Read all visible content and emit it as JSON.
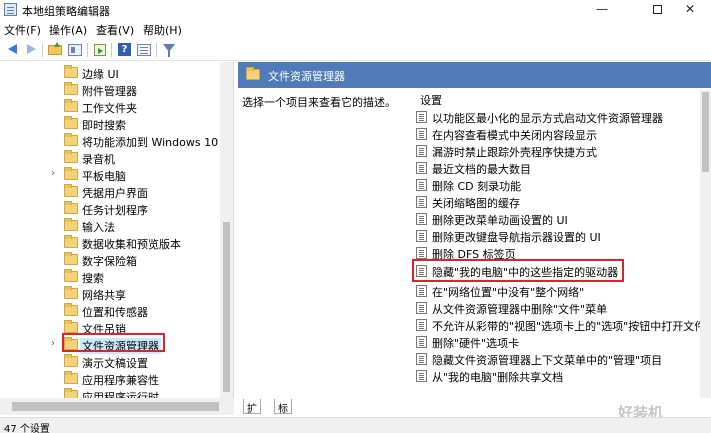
{
  "window": {
    "title": "本地组策略编辑器",
    "controls": {
      "minimize": "—",
      "close": "✕"
    }
  },
  "menu": [
    "文件(F)",
    "操作(A)",
    "查看(V)",
    "帮助(H)"
  ],
  "toolbar_icons": [
    "back-icon",
    "forward-icon",
    "folder-up-icon",
    "show-hide-tree-icon",
    "export-icon",
    "help-icon",
    "properties-icon",
    "filter-icon"
  ],
  "tree": {
    "items": [
      {
        "label": "边缘 UI",
        "expandable": false
      },
      {
        "label": "附件管理器",
        "expandable": false
      },
      {
        "label": "工作文件夹",
        "expandable": false
      },
      {
        "label": "即时搜索",
        "expandable": false
      },
      {
        "label": "将功能添加到 Windows 10",
        "expandable": false
      },
      {
        "label": "录音机",
        "expandable": false
      },
      {
        "label": "平板电脑",
        "expandable": true
      },
      {
        "label": "凭据用户界面",
        "expandable": false
      },
      {
        "label": "任务计划程序",
        "expandable": false
      },
      {
        "label": "输入法",
        "expandable": false
      },
      {
        "label": "数据收集和预览版本",
        "expandable": false
      },
      {
        "label": "数字保险箱",
        "expandable": false
      },
      {
        "label": "搜索",
        "expandable": false
      },
      {
        "label": "网络共享",
        "expandable": false
      },
      {
        "label": "位置和传感器",
        "expandable": false
      },
      {
        "label": "文件吊销",
        "expandable": false
      },
      {
        "label": "文件资源管理器",
        "expandable": true,
        "selected": true
      },
      {
        "label": "演示文稿设置",
        "expandable": false
      },
      {
        "label": "应用程序兼容性",
        "expandable": false
      },
      {
        "label": "应用程序运行时",
        "expandable": false
      }
    ],
    "expand_glyph": "›"
  },
  "right": {
    "header_title": "文件资源管理器",
    "description": "选择一个项目来查看它的描述。",
    "settings_header": "设置",
    "settings": [
      "以功能区最小化的显示方式启动文件资源管理器",
      "在内容查看模式中关闭内容段显示",
      "漏游时禁止跟踪外壳程序快捷方式",
      "最近文档的最大数目",
      "删除 CD 刻录功能",
      "关闭缩略图的缓存",
      "删除更改菜单动画设置的 UI",
      "删除更改键盘导航指示器设置的 UI",
      "删除 DFS 标签页",
      "隐藏\"我的电脑\"中的这些指定的驱动器",
      "在\"网络位置\"中没有\"整个网络\"",
      "从文件资源管理器中删除\"文件\"菜单",
      "不允许从彩带的\"视图\"选项卡上的\"选项\"按钮中打开文件夹...",
      "删除\"硬件\"选项卡",
      "隐藏文件资源管理器上下文菜单中的\"管理\"项目",
      "从\"我的电脑\"删除共享文档"
    ]
  },
  "tabs": [
    "扩展",
    "标准"
  ],
  "status": "47 个设置",
  "watermark": "好装机",
  "colors": {
    "header_bg": "#4f7bb8",
    "highlight_box": "#e0202a",
    "selection": "#cce8ff"
  }
}
